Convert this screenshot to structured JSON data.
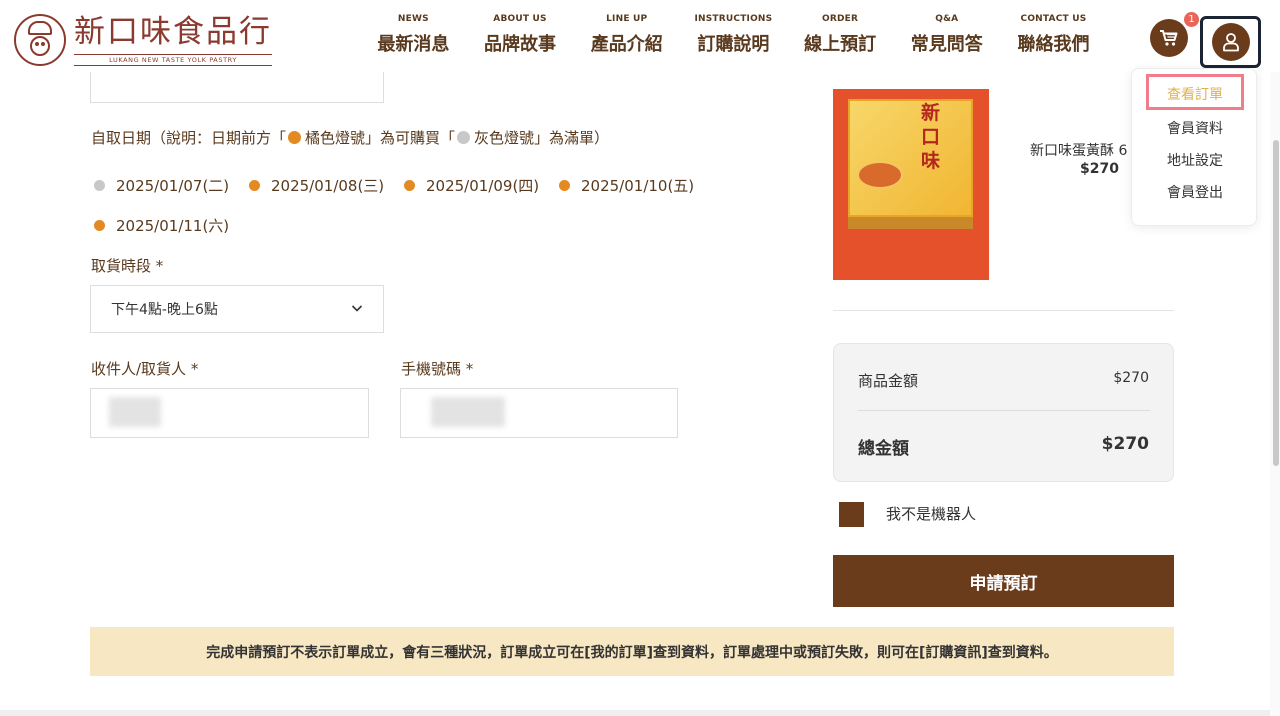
{
  "header": {
    "logo_cn": "新口味食品行",
    "logo_en": "LUKANG NEW TASTE YOLK PASTRY",
    "nav": [
      {
        "en": "NEWS",
        "cn": "最新消息"
      },
      {
        "en": "ABOUT US",
        "cn": "品牌故事"
      },
      {
        "en": "LINE UP",
        "cn": "產品介紹"
      },
      {
        "en": "INSTRUCTIONS",
        "cn": "訂購說明"
      },
      {
        "en": "ORDER",
        "cn": "線上預訂"
      },
      {
        "en": "Q&A",
        "cn": "常見問答"
      },
      {
        "en": "CONTACT US",
        "cn": "聯絡我們"
      }
    ],
    "cart_count": "1",
    "cart_icon": "cart-icon",
    "user_icon": "user-icon"
  },
  "user_menu": {
    "items": [
      "查看訂單",
      "會員資料",
      "地址設定",
      "會員登出"
    ],
    "active_index": 0
  },
  "form": {
    "pickup_date_title_a": "自取日期（說明：日期前方「",
    "pickup_date_title_b": "橘色燈號」為可購買「",
    "pickup_date_title_c": "灰色燈號」為滿單）",
    "dates": [
      {
        "label": "2025/01/07(二)",
        "status": "full"
      },
      {
        "label": "2025/01/08(三)",
        "status": "available"
      },
      {
        "label": "2025/01/09(四)",
        "status": "available"
      },
      {
        "label": "2025/01/10(五)",
        "status": "available"
      },
      {
        "label": "2025/01/11(六)",
        "status": "available"
      }
    ],
    "time_label": "取貨時段 *",
    "time_value": "下午4點-晚上6點",
    "receiver_label": "收件人/取貨人 *",
    "phone_label": "手機號碼 *"
  },
  "colors": {
    "available": "#e38a23",
    "full": "#c8c8c8",
    "brand_brown": "#6b3c1c"
  },
  "order": {
    "product_name": "新口味蛋黃酥 6",
    "product_price": "$270",
    "product_box_text": "新口味",
    "subtotal_label": "商品金額",
    "subtotal_value": "$270",
    "total_label": "總金額",
    "total_value": "$270",
    "captcha_label": "我不是機器人",
    "submit_label": "申請預訂"
  },
  "notice": "完成申請預訂不表示訂單成立，會有三種狀況，訂單成立可在[我的訂單]查到資料，訂單處理中或預訂失敗，則可在[訂購資訊]查到資料。"
}
